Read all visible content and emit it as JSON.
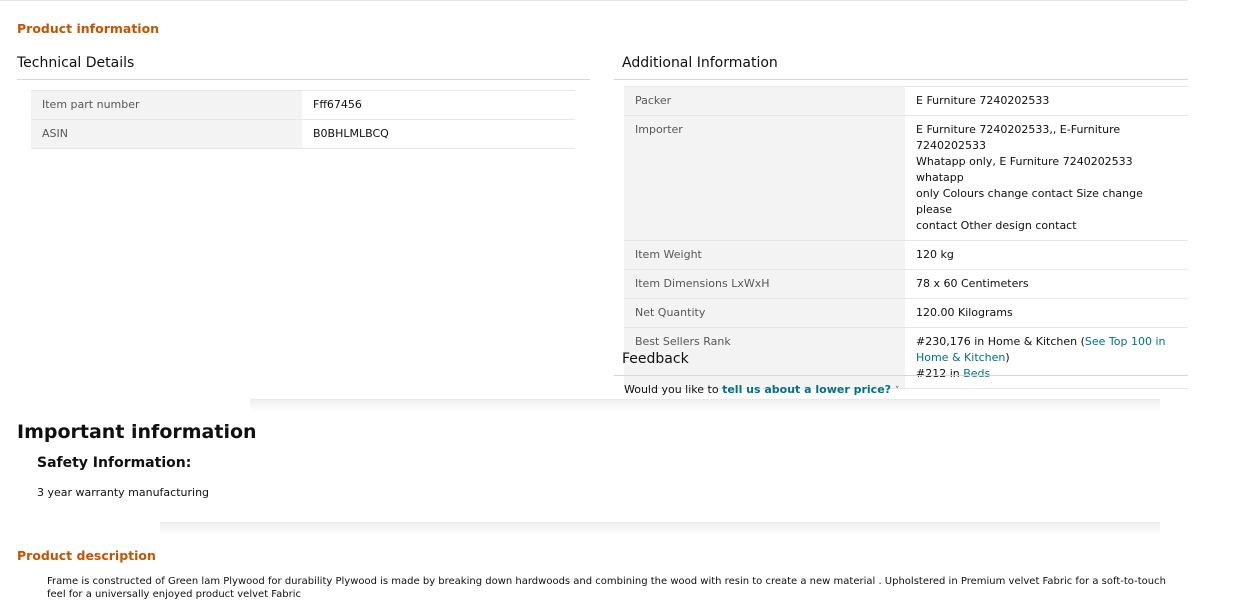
{
  "product_information": {
    "title": "Product information"
  },
  "technical_details": {
    "title": "Technical Details",
    "rows": [
      {
        "label": "Item part number",
        "value": "Fff67456"
      },
      {
        "label": "ASIN",
        "value": "B0BHLMLBCQ"
      }
    ]
  },
  "additional_information": {
    "title": "Additional Information",
    "rows": [
      {
        "label": "Packer",
        "value": "E Furniture 7240202533"
      },
      {
        "label": "Importer",
        "value_lines": [
          "E Furniture 7240202533,, E-Furniture 7240202533",
          "Whatapp only, E Furniture 7240202533 whatapp",
          "only Colours change contact Size change please",
          "contact Other design contact"
        ]
      },
      {
        "label": "Item Weight",
        "value": "120 kg"
      },
      {
        "label": "Item Dimensions LxWxH",
        "value": "78 x 60 Centimeters"
      },
      {
        "label": "Net Quantity",
        "value": "120.00 Kilograms"
      },
      {
        "label": "Best Sellers Rank",
        "rank1_text": "#230,176 in Home & Kitchen (",
        "rank1_link": "See Top 100 in",
        "rank1_link2": "Home & Kitchen",
        "rank1_close": ")",
        "rank2_text": "#212 in ",
        "rank2_link": "Beds"
      }
    ]
  },
  "feedback": {
    "title": "Feedback",
    "prefix": "Would you like to ",
    "link": "tell us about a lower price?",
    "chevron": "˅"
  },
  "important_information": {
    "title": "Important information",
    "safety_title": "Safety Information:",
    "safety_text": "3 year warranty manufacturing"
  },
  "product_description": {
    "title": "Product description",
    "text": "Frame is constructed of Green lam Plywood for durability Plywood is made by breaking down hardwoods and combining the wood with resin to create a new material . Upholstered in Premium velvet Fabric for a soft-to-touch feel for a universally enjoyed product velvet Fabric"
  },
  "colors": {
    "accent_orange": "#c45500",
    "link_teal": "#007185",
    "label_bg": "#f3f3f3"
  }
}
